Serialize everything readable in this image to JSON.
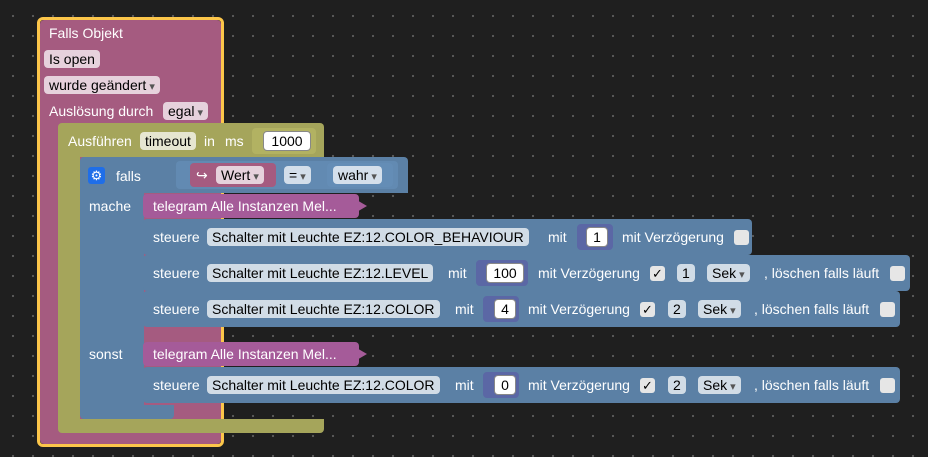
{
  "trigger": {
    "label_falls_objekt": "Falls Objekt",
    "object_field": "Is open",
    "change_field": "wurde geändert",
    "trigger_label": "Auslösung durch",
    "trigger_field": "egal"
  },
  "timeout": {
    "label_run": "Ausführen",
    "name_field": "timeout",
    "label_in": "in",
    "label_ms": "ms",
    "ms_value": "1000"
  },
  "if_block": {
    "label_falls": "falls",
    "var_field": "Wert",
    "op_field": "=",
    "bool_field": "wahr",
    "label_mache": "mache",
    "label_sonst": "sonst"
  },
  "telegram": [
    {
      "label": "telegram Alle Instanzen Mel..."
    },
    {
      "label": "telegram Alle Instanzen Mel..."
    }
  ],
  "controls": [
    {
      "label": "steuere",
      "object": "Schalter mit Leuchte EZ:12.COLOR_BEHAVIOUR",
      "mit": "mit",
      "value": "1",
      "delay_label": "mit Verzögerung",
      "checked": "",
      "delay": "",
      "unit": "",
      "clear": ""
    },
    {
      "label": "steuere",
      "object": "Schalter mit Leuchte EZ:12.LEVEL",
      "mit": "mit",
      "value": "100",
      "delay_label": "mit Verzögerung",
      "checked": "✓",
      "delay": "1",
      "unit": "Sek",
      "clear": ", löschen falls läuft"
    },
    {
      "label": "steuere",
      "object": "Schalter mit Leuchte EZ:12.COLOR",
      "mit": "mit",
      "value": "4",
      "delay_label": "mit Verzögerung",
      "checked": "✓",
      "delay": "2",
      "unit": "Sek",
      "clear": ", löschen falls läuft"
    },
    {
      "label": "steuere",
      "object": "Schalter mit Leuchte EZ:12.COLOR",
      "mit": "mit",
      "value": "0",
      "delay_label": "mit Verzögerung",
      "checked": "✓",
      "delay": "2",
      "unit": "Sek",
      "clear": ", löschen falls läuft"
    }
  ],
  "colors": {
    "trigger": "#a55b80",
    "timeout": "#a5a55b",
    "logic": "#5b80a5",
    "telegram": "#a55b99",
    "selected_outline": "#fcc64a"
  }
}
